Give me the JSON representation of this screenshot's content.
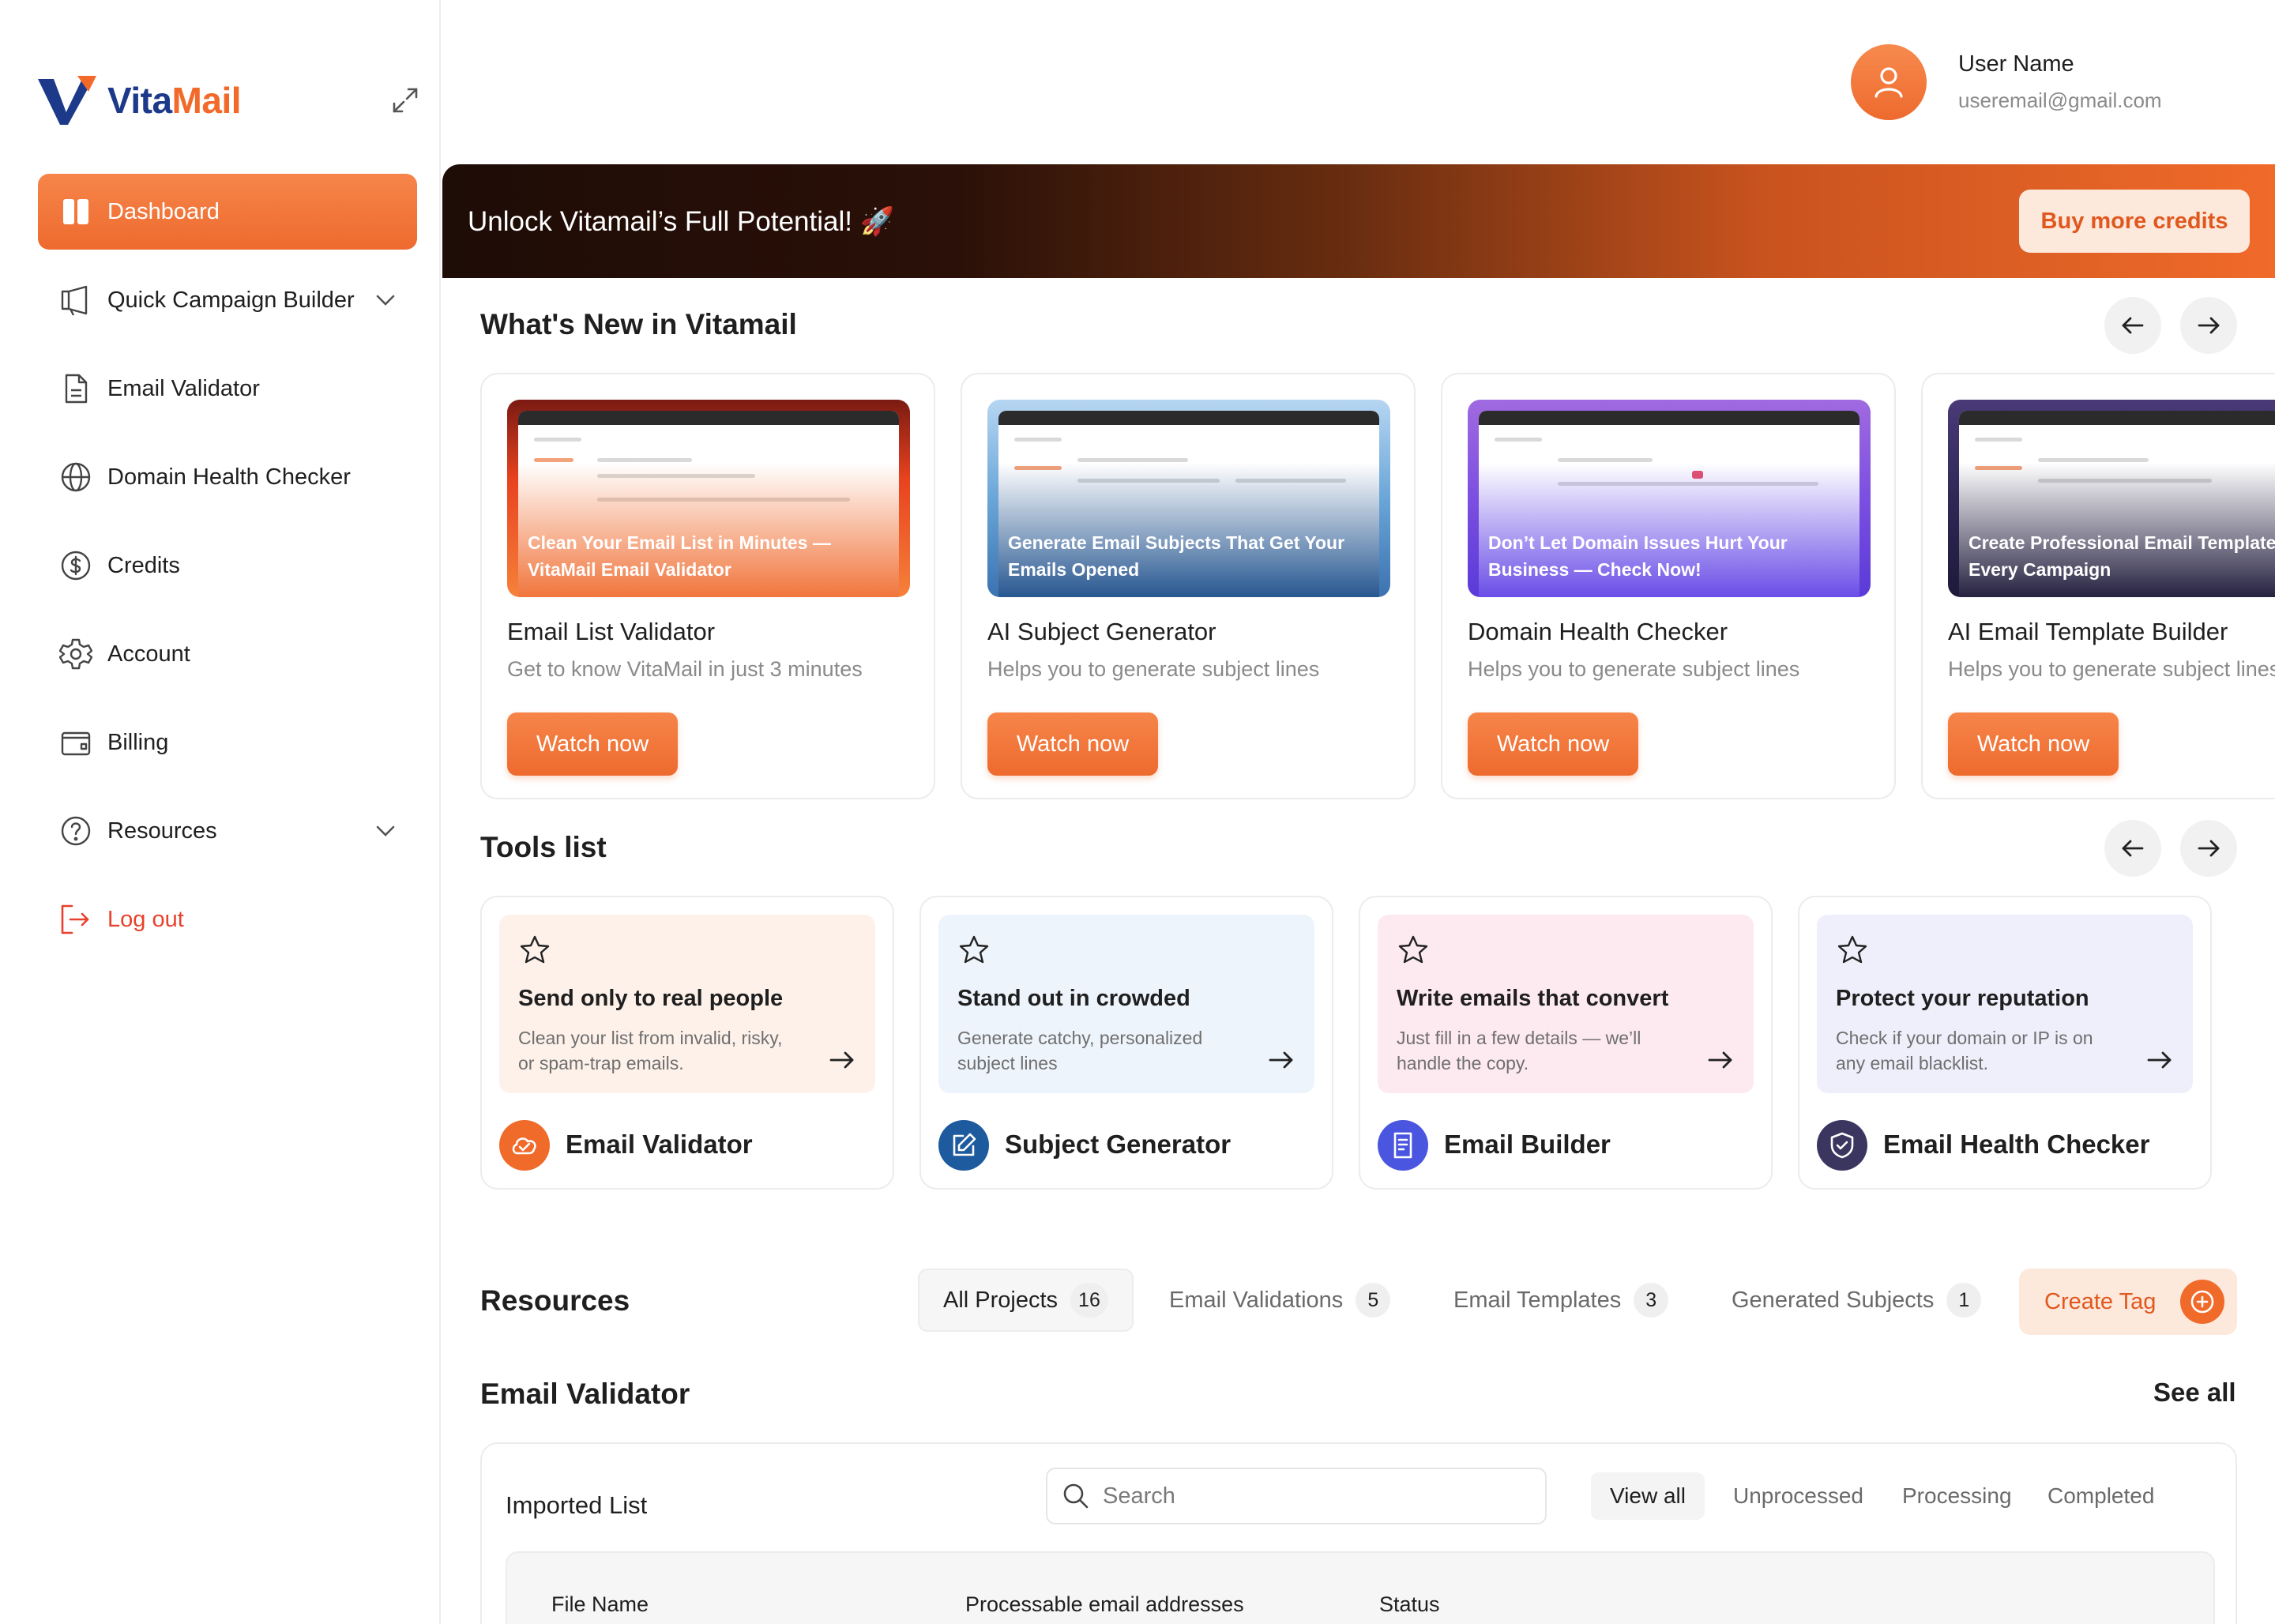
{
  "brand": {
    "name_part1": "Vita",
    "name_part2": "Mail"
  },
  "sidebar": {
    "items": [
      {
        "label": "Dashboard",
        "icon": "dashboard-icon"
      },
      {
        "label": "Quick Campaign Builder",
        "icon": "megaphone-icon"
      },
      {
        "label": "Email Validator",
        "icon": "document-icon"
      },
      {
        "label": "Domain Health Checker",
        "icon": "globe-icon"
      },
      {
        "label": "Credits",
        "icon": "dollar-icon"
      },
      {
        "label": "Account",
        "icon": "gear-icon"
      },
      {
        "label": "Billing",
        "icon": "wallet-icon"
      },
      {
        "label": "Resources",
        "icon": "help-circle-icon"
      },
      {
        "label": "Log out",
        "icon": "logout-icon"
      }
    ]
  },
  "user": {
    "name": "User Name",
    "email": "useremail@gmail.com"
  },
  "banner": {
    "title": "Unlock Vitamail’s Full Potential! 🚀",
    "button": "Buy more credits"
  },
  "whats_new": {
    "title": "What's New in Vitamail",
    "cards": [
      {
        "caption": "Clean Your Email List in Minutes — VitaMail Email Validator",
        "name": "Email List Validator",
        "desc": "Get to know VitaMail in just 3 minutes",
        "button": "Watch now"
      },
      {
        "caption": "Generate Email Subjects That Get Your Emails Opened",
        "name": "AI Subject Generator",
        "desc": "Helps you to generate subject lines",
        "button": "Watch now"
      },
      {
        "caption": "Don’t Let Domain Issues Hurt Your Business — Check Now!",
        "name": "Domain Health Checker",
        "desc": "Helps you to generate subject lines",
        "button": "Watch now"
      },
      {
        "caption": "Create Professional Email Templates Fast — Perfect for Every Campaign",
        "name": "AI Email Template Builder",
        "desc": "Helps you to generate subject lines",
        "button": "Watch now"
      }
    ]
  },
  "tools": {
    "title": "Tools list",
    "cards": [
      {
        "heading": "Send only to real people",
        "desc": "Clean your list from invalid, risky, or spam-trap emails.",
        "name": "Email Validator",
        "color": "#f06a2a"
      },
      {
        "heading": "Stand out in crowded",
        "desc": "Generate catchy, personalized subject lines",
        "name": "Subject Generator",
        "color": "#1d5a9e"
      },
      {
        "heading": "Write emails that convert",
        "desc": "Just fill in a few details — we’ll handle the copy.",
        "name": "Email Builder",
        "color": "#4a55e0"
      },
      {
        "heading": "Protect your reputation",
        "desc": "Check if your domain or IP is on any email blacklist.",
        "name": "Email Health Checker",
        "color": "#3a3660"
      }
    ]
  },
  "resources": {
    "title": "Resources",
    "tabs": [
      {
        "label": "All Projects",
        "count": "16"
      },
      {
        "label": "Email Validations",
        "count": "5"
      },
      {
        "label": "Email Templates",
        "count": "3"
      },
      {
        "label": "Generated Subjects",
        "count": "1"
      }
    ],
    "create_tag": "Create Tag"
  },
  "validator": {
    "title": "Email Validator",
    "see_all": "See all",
    "list_title": "Imported List",
    "search_placeholder": "Search",
    "filters": [
      "View all",
      "Unprocessed",
      "Processing",
      "Completed"
    ],
    "columns": [
      "File Name",
      "Processable email addresses",
      "Status"
    ]
  }
}
